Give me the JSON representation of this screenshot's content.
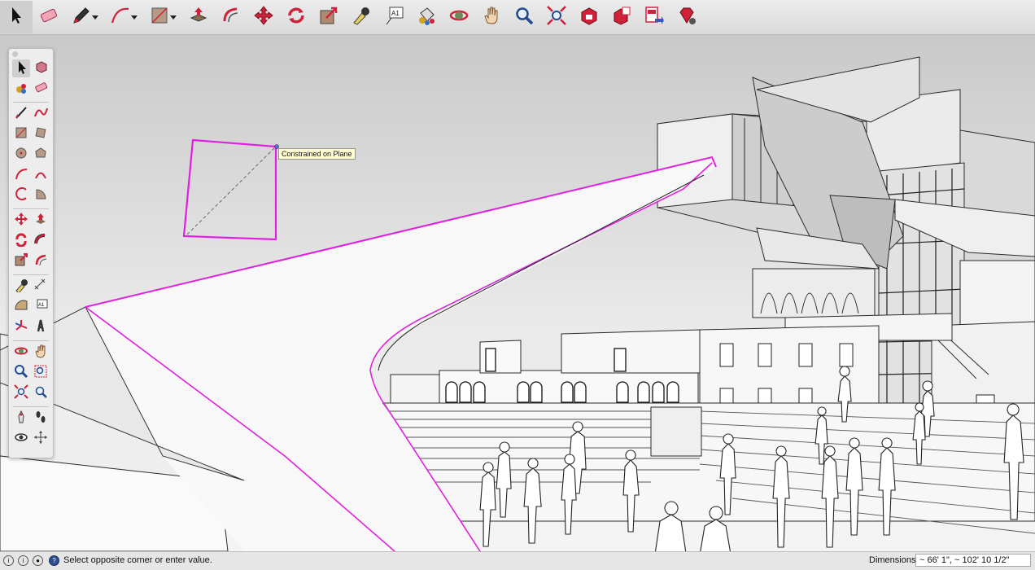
{
  "toolbar": {
    "tools": [
      {
        "name": "select",
        "icon": "arrow-icon",
        "active": true
      },
      {
        "name": "eraser",
        "icon": "eraser-icon"
      },
      {
        "name": "line",
        "icon": "pencil-icon",
        "dropdown": true
      },
      {
        "name": "arc",
        "icon": "arc-icon",
        "dropdown": true
      },
      {
        "name": "rectangle",
        "icon": "rectangle-icon",
        "dropdown": true
      },
      {
        "name": "push-pull",
        "icon": "push-pull-icon"
      },
      {
        "name": "offset",
        "icon": "offset-icon"
      },
      {
        "name": "move",
        "icon": "move-icon"
      },
      {
        "name": "rotate",
        "icon": "rotate-icon"
      },
      {
        "name": "scale",
        "icon": "scale-icon"
      },
      {
        "name": "tape-measure",
        "icon": "tape-measure-icon"
      },
      {
        "name": "text",
        "icon": "text-icon",
        "text": "A1"
      },
      {
        "name": "paint-bucket",
        "icon": "paint-bucket-icon"
      },
      {
        "name": "orbit",
        "icon": "orbit-icon"
      },
      {
        "name": "pan",
        "icon": "hand-icon"
      },
      {
        "name": "zoom",
        "icon": "zoom-icon"
      },
      {
        "name": "zoom-extents",
        "icon": "zoom-extents-icon"
      },
      {
        "name": "3d-warehouse",
        "icon": "warehouse-icon"
      },
      {
        "name": "extension-warehouse",
        "icon": "extension-warehouse-icon"
      },
      {
        "name": "send-to-layout",
        "icon": "layout-icon"
      },
      {
        "name": "extension-manager",
        "icon": "ruby-gem-icon"
      }
    ]
  },
  "palette": {
    "rows": [
      [
        "select",
        "component"
      ],
      [
        "paint-bucket",
        "eraser"
      ],
      [
        "line",
        "freehand"
      ],
      [
        "rectangle",
        "rotated-rectangle"
      ],
      [
        "circle",
        "polygon"
      ],
      [
        "arc",
        "two-point-arc"
      ],
      [
        "three-point-arc",
        "pie"
      ],
      [
        "move",
        "push-pull"
      ],
      [
        "rotate",
        "follow-me"
      ],
      [
        "scale",
        "offset"
      ],
      [
        "tape-measure",
        "dimension"
      ],
      [
        "protractor",
        "text"
      ],
      [
        "axes",
        "3d-text"
      ],
      [
        "orbit",
        "pan"
      ],
      [
        "zoom",
        "zoom-window"
      ],
      [
        "zoom-extents",
        "previous"
      ],
      [
        "position-camera",
        "walk"
      ],
      [
        "look-around",
        "section-plane"
      ]
    ]
  },
  "viewport": {
    "tooltip": "Constrained on Plane"
  },
  "status": {
    "message": "Select opposite corner or enter value.",
    "dimensions_label": "Dimensions",
    "dimensions_value": "~ 66' 1\", ~ 102' 10 1/2\""
  },
  "colors": {
    "selection": "#e020e0",
    "accent": "#d0213b"
  }
}
